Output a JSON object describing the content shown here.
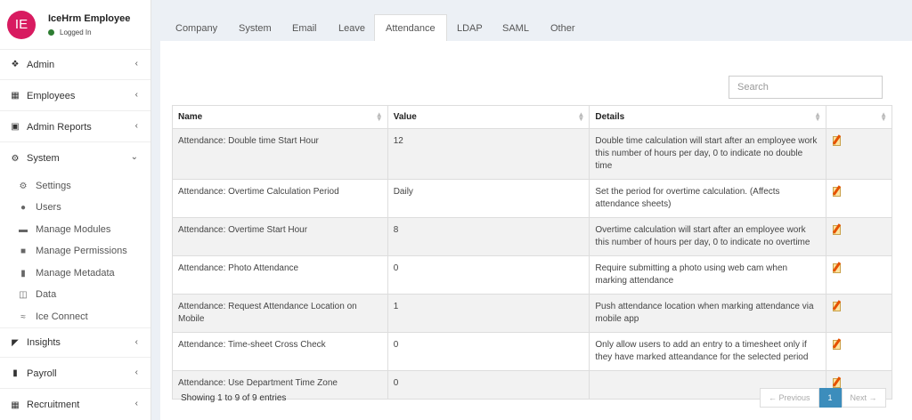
{
  "user": {
    "initials": "IE",
    "name": "IceHrm Employee",
    "status": "Logged In"
  },
  "sidebar": {
    "items": [
      {
        "label": "Admin",
        "icon": "cubes-icon"
      },
      {
        "label": "Employees",
        "icon": "grid-icon"
      },
      {
        "label": "Admin Reports",
        "icon": "briefcase-icon"
      },
      {
        "label": "System",
        "icon": "cogs-icon"
      },
      {
        "label": "Insights",
        "icon": "area-chart-icon"
      },
      {
        "label": "Payroll",
        "icon": "file-icon"
      },
      {
        "label": "Recruitment",
        "icon": "grid-icon"
      }
    ],
    "system_submenu": [
      {
        "label": "Settings",
        "icon": "cogs-icon"
      },
      {
        "label": "Users",
        "icon": "user-icon"
      },
      {
        "label": "Manage Modules",
        "icon": "folder-icon"
      },
      {
        "label": "Manage Permissions",
        "icon": "lock-icon"
      },
      {
        "label": "Manage Metadata",
        "icon": "book-icon"
      },
      {
        "label": "Data",
        "icon": "database-icon"
      },
      {
        "label": "Ice Connect",
        "icon": "wifi-icon"
      }
    ]
  },
  "tabs": [
    "Company",
    "System",
    "Email",
    "Leave",
    "Attendance",
    "LDAP",
    "SAML",
    "Other"
  ],
  "active_tab": "Attendance",
  "search": {
    "placeholder": "Search"
  },
  "table": {
    "columns": [
      "Name",
      "Value",
      "Details",
      ""
    ],
    "rows": [
      {
        "name": "Attendance: Double time Start Hour",
        "value": "12",
        "details": "Double time calculation will start after an employee work this number of hours per day, 0 to indicate no double time"
      },
      {
        "name": "Attendance: Overtime Calculation Period",
        "value": "Daily",
        "details": "Set the period for overtime calculation. (Affects attendance sheets)"
      },
      {
        "name": "Attendance: Overtime Start Hour",
        "value": "8",
        "details": "Overtime calculation will start after an employee work this number of hours per day, 0 to indicate no overtime"
      },
      {
        "name": "Attendance: Photo Attendance",
        "value": "0",
        "details": "Require submitting a photo using web cam when marking attendance"
      },
      {
        "name": "Attendance: Request Attendance Location on Mobile",
        "value": "1",
        "details": "Push attendance location when marking attendance via mobile app"
      },
      {
        "name": "Attendance: Time-sheet Cross Check",
        "value": "0",
        "details": "Only allow users to add an entry to a timesheet only if they have marked atteandance for the selected period"
      },
      {
        "name": "Attendance: Use Department Time Zone",
        "value": "0",
        "details": ""
      }
    ]
  },
  "footer": {
    "info": "Showing 1 to 9 of 9 entries"
  },
  "pagination": {
    "previous": "← Previous",
    "current": "1",
    "next": "Next →"
  },
  "colors": {
    "avatar": "#d81b60",
    "accent": "#3c8dbc",
    "online": "#2e7d32"
  }
}
